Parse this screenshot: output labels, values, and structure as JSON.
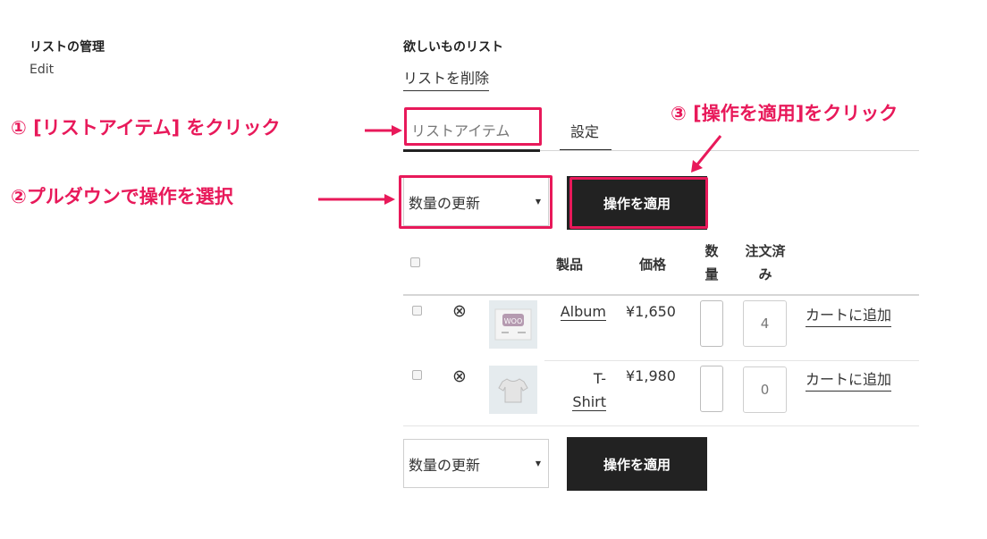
{
  "left": {
    "heading": "リストの管理",
    "edit_label": "Edit"
  },
  "wishlist": {
    "title": "欲しいものリスト",
    "delete_label": "リストを削除",
    "tabs": [
      {
        "label": "リストアイテム",
        "active": true
      },
      {
        "label": "設定",
        "active": false
      }
    ]
  },
  "bulk_action": {
    "select_value": "数量の更新",
    "apply_label": "操作を適用"
  },
  "table": {
    "headers": {
      "product": "製品",
      "price": "価格",
      "qty_line1": "数",
      "qty_line2": "量",
      "ordered_line1": "注文済",
      "ordered_line2": "み"
    },
    "rows": [
      {
        "product_line1": "Album",
        "product_line2": "",
        "price": "¥1,650",
        "ordered": "4",
        "cart_label": "カートに追加",
        "thumb_icon": "woo-album-thumbnail"
      },
      {
        "product_line1": "T-",
        "product_line2": "Shirt",
        "price": "¥1,980",
        "ordered": "0",
        "cart_label": "カートに追加",
        "thumb_icon": "tshirt-thumbnail"
      }
    ]
  },
  "annotations": {
    "step1": "① [リストアイテム] をクリック",
    "step2": "②プルダウンで操作を選択",
    "step3": "③ [操作を適用]をクリック",
    "color": "#e8195a"
  }
}
